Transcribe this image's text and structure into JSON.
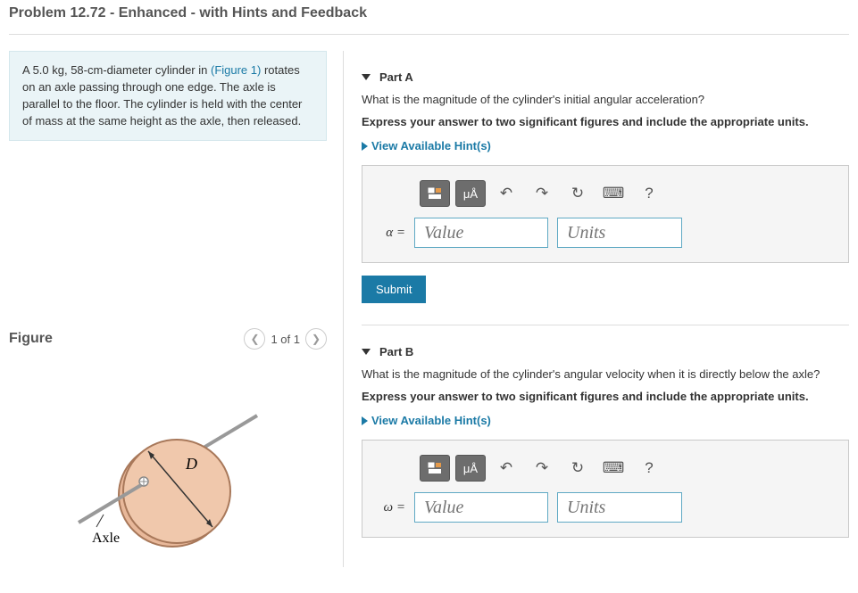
{
  "title": "Problem 12.72 - Enhanced - with Hints and Feedback",
  "problem": {
    "pre_text": "A 5.0 kg, 58-cm-diameter cylinder in ",
    "figure_link": "(Figure 1)",
    "post_text": " rotates on an axle passing through one edge. The axle is parallel to the floor. The cylinder is held with the center of mass at the same height as the axle, then released."
  },
  "figure": {
    "title": "Figure",
    "pager": "1 of 1",
    "labels": {
      "D": "D",
      "axle": "Axle"
    }
  },
  "partA": {
    "title": "Part A",
    "question": "What is the magnitude of the cylinder's initial angular acceleration?",
    "instruction": "Express your answer to two significant figures and include the appropriate units.",
    "hints_link": "View Available Hint(s)",
    "var": "α =",
    "value_ph": "Value",
    "units_ph": "Units",
    "submit": "Submit",
    "toolbar_mu": "μÅ"
  },
  "partB": {
    "title": "Part B",
    "question": "What is the magnitude of the cylinder's angular velocity when it is directly below the axle?",
    "instruction": "Express your answer to two significant figures and include the appropriate units.",
    "hints_link": "View Available Hint(s)",
    "var": "ω =",
    "value_ph": "Value",
    "units_ph": "Units",
    "toolbar_mu": "μÅ"
  }
}
